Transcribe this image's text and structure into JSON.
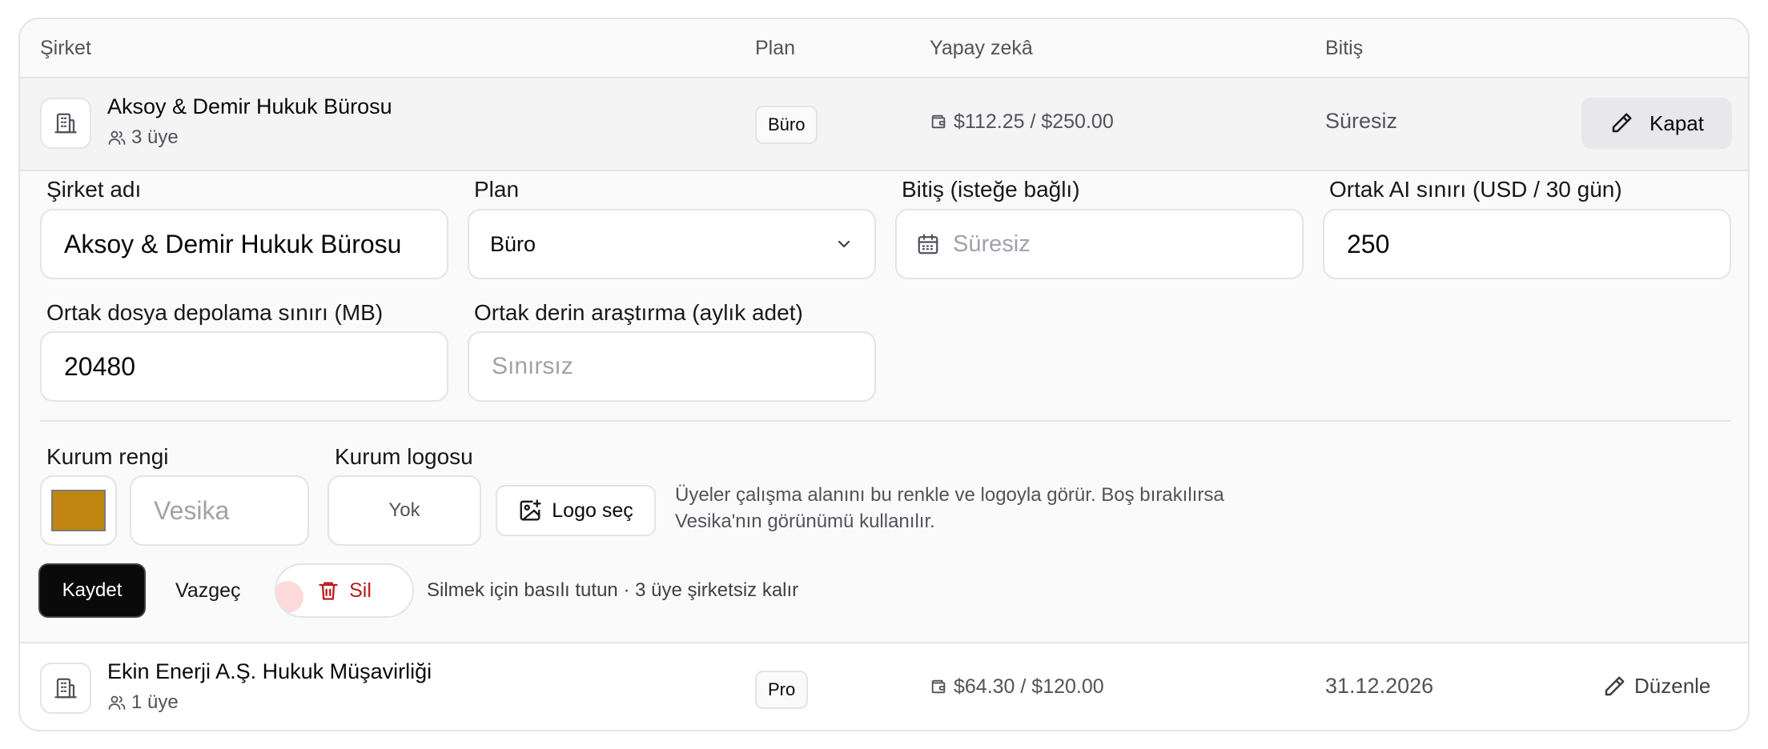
{
  "table": {
    "headers": {
      "company": "Şirket",
      "plan": "Plan",
      "ai": "Yapay zekâ",
      "expiry": "Bitiş"
    }
  },
  "companies": [
    {
      "name": "Aksoy & Demir Hukuk Bürosu",
      "members": "3 üye",
      "plan": "Büro",
      "ai_usage": "$112.25 / $250.00",
      "expiry": "Süresiz",
      "action": "Kapat"
    },
    {
      "name": "Ekin Enerji A.Ş. Hukuk Müşavirliği",
      "members": "1 üye",
      "plan": "Pro",
      "ai_usage": "$64.30 / $120.00",
      "expiry": "31.12.2026",
      "action": "Düzenle"
    }
  ],
  "edit": {
    "company_name_label": "Şirket adı",
    "company_name_value": "Aksoy & Demir Hukuk Bürosu",
    "plan_label": "Plan",
    "plan_value": "Büro",
    "expiry_label": "Bitiş (isteğe bağlı)",
    "expiry_placeholder": "Süresiz",
    "ai_limit_label": "Ortak AI sınırı (USD / 30 gün)",
    "ai_limit_value": "250",
    "storage_label": "Ortak dosya depolama sınırı (MB)",
    "storage_value": "20480",
    "research_label": "Ortak derin araştırma (aylık adet)",
    "research_placeholder": "Sınırsız",
    "brand_color_label": "Kurum rengi",
    "brand_color_value": "#c0860f",
    "brand_name_placeholder": "Vesika",
    "logo_label": "Kurum logosu",
    "logo_value": "Yok",
    "logo_button": "Logo seç",
    "help_text": "Üyeler çalışma alanını bu renkle ve logoyla görür. Boş bırakılırsa Vesika'nın görünümü kullanılır.",
    "save": "Kaydet",
    "cancel": "Vazgeç",
    "delete": "Sil",
    "delete_note": "Silmek için basılı tutun · 3 üye şirketsiz kalır"
  },
  "colors": {
    "danger": "#b91c1c",
    "primary_button": "#0a0a0a"
  }
}
